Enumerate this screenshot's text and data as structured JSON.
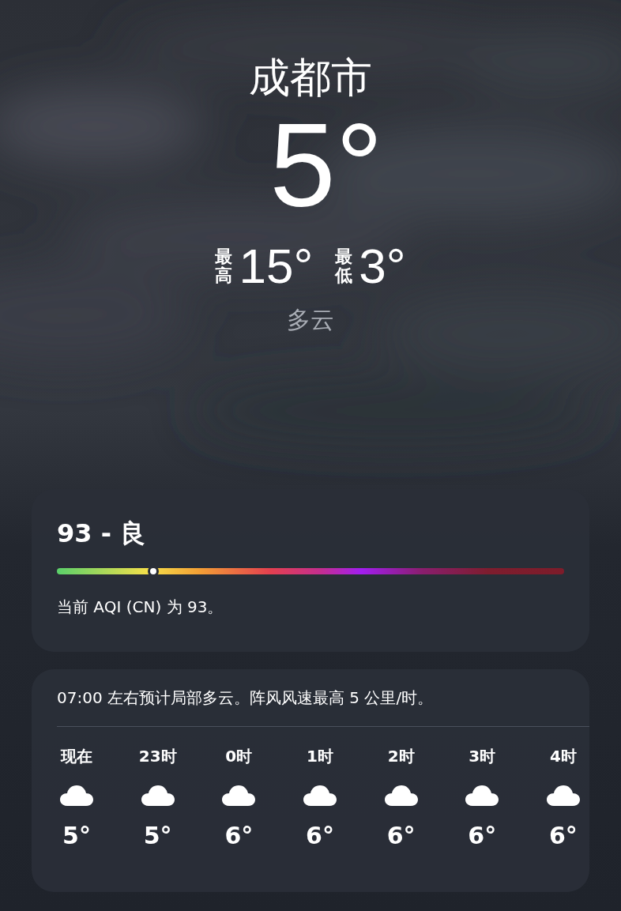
{
  "location": "成都市",
  "temperature": "5°",
  "high_label": "最高",
  "high": "15°",
  "low_label": "最低",
  "low": "3°",
  "condition": "多云",
  "aqi": {
    "title": "93 - 良",
    "level": 0.19,
    "description": "当前 AQI (CN) 为 93。"
  },
  "hourly": {
    "summary": "07:00 左右预计局部多云。阵风风速最高 5 公里/时。",
    "hours": [
      {
        "time": "现在",
        "kind": "cloud",
        "temp": "5°"
      },
      {
        "time": "23时",
        "kind": "cloud",
        "temp": "5°"
      },
      {
        "time": "0时",
        "kind": "cloud",
        "temp": "6°"
      },
      {
        "time": "1时",
        "kind": "cloud",
        "temp": "6°"
      },
      {
        "time": "2时",
        "kind": "cloud",
        "temp": "6°"
      },
      {
        "time": "3时",
        "kind": "cloud",
        "temp": "6°"
      },
      {
        "time": "4时",
        "kind": "cloud",
        "temp": "6°"
      }
    ]
  }
}
